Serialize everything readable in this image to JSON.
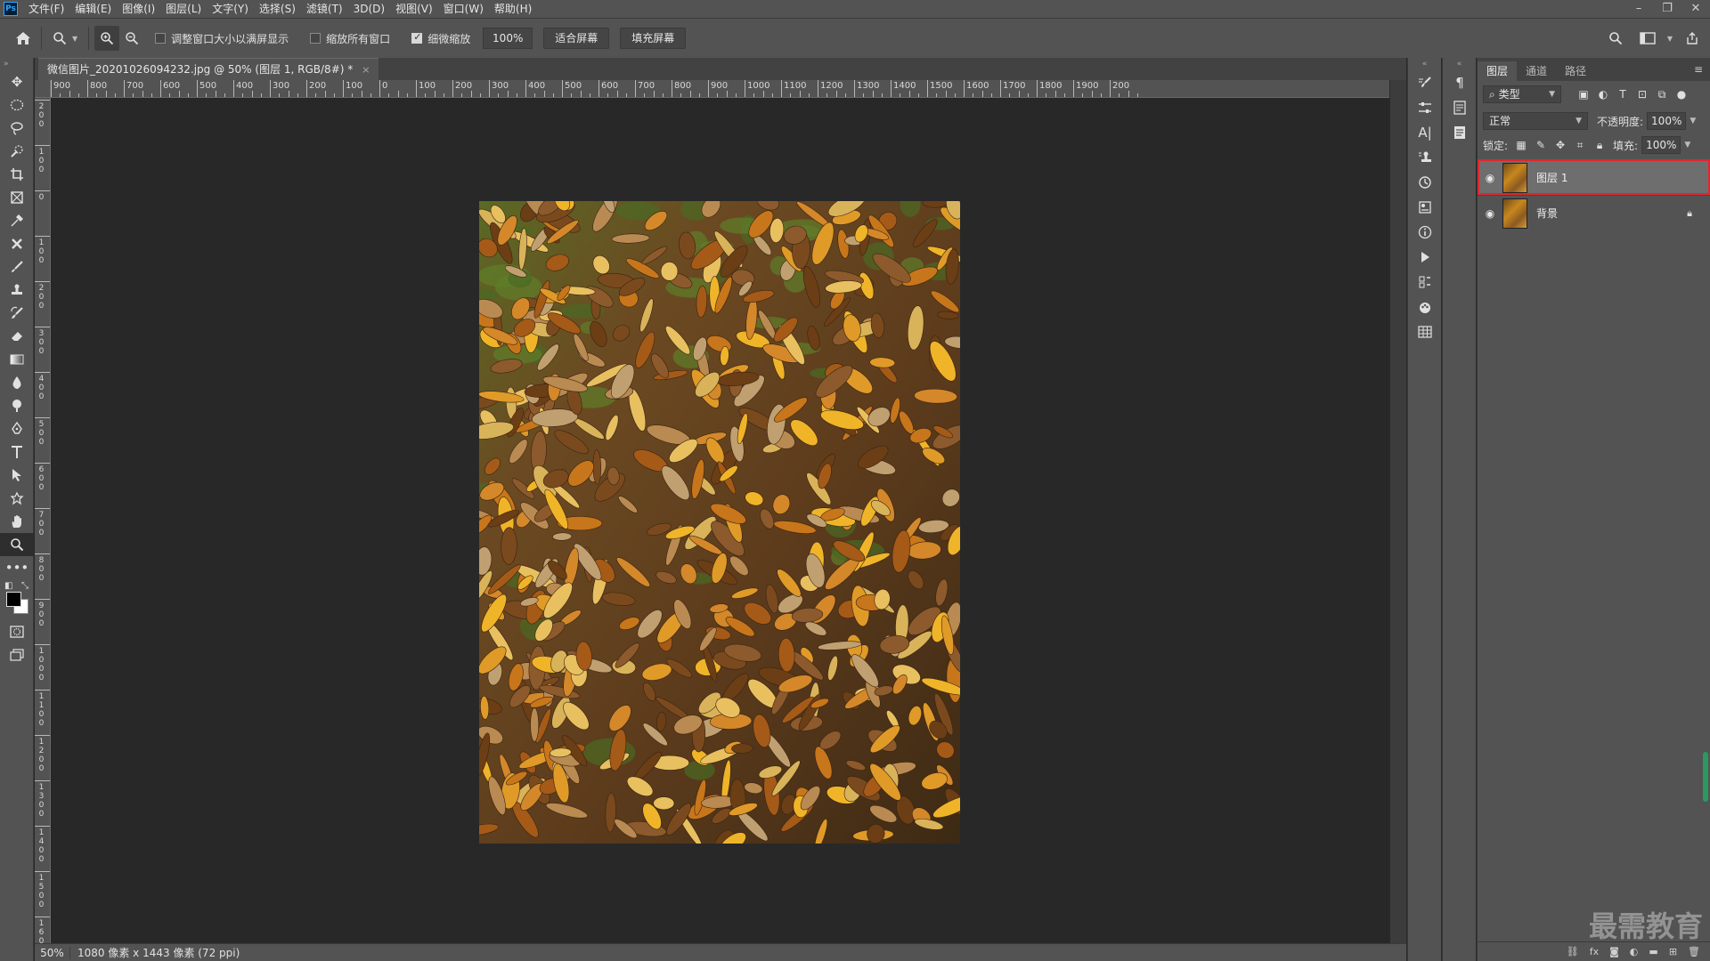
{
  "app": {
    "logo": "Ps"
  },
  "menu": [
    "文件(F)",
    "编辑(E)",
    "图像(I)",
    "图层(L)",
    "文字(Y)",
    "选择(S)",
    "滤镜(T)",
    "3D(D)",
    "视图(V)",
    "窗口(W)",
    "帮助(H)"
  ],
  "window_controls": {
    "minimize": "–",
    "restore": "❐",
    "close": "✕"
  },
  "options": {
    "resize_windows_label": "调整窗口大小以满屏显示",
    "resize_windows_checked": false,
    "zoom_all_label": "缩放所有窗口",
    "zoom_all_checked": false,
    "scrubby_zoom_label": "细微缩放",
    "scrubby_zoom_checked": true,
    "zoom_value": "100%",
    "fit_screen_label": "适合屏幕",
    "fill_screen_label": "填充屏幕"
  },
  "document": {
    "tab_title": "微信图片_20201026094232.jpg @ 50% (图层 1, RGB/8#) *",
    "close": "×"
  },
  "ruler": {
    "top_labels": [
      "900",
      "800",
      "700",
      "600",
      "500",
      "400",
      "300",
      "200",
      "100",
      "0",
      "100",
      "200",
      "300",
      "400",
      "500",
      "600",
      "700",
      "800",
      "900",
      "1000",
      "1100",
      "1200",
      "1300",
      "1400",
      "1500",
      "1600",
      "1700",
      "1800",
      "1900",
      "200"
    ],
    "left_labels": [
      "200",
      "100",
      "0",
      "100",
      "200",
      "300",
      "400",
      "500",
      "600",
      "700",
      "800",
      "900",
      "1000",
      "1100",
      "1200",
      "1300",
      "1400",
      "1500",
      "1600"
    ]
  },
  "status": {
    "zoom": "50%",
    "info": "1080 像素 x 1443 像素 (72 ppi)"
  },
  "layers_panel": {
    "tabs": [
      "图层",
      "通道",
      "路径"
    ],
    "active_tab": 0,
    "filter_type": "类型",
    "blend_mode": "正常",
    "opacity_label": "不透明度:",
    "opacity_value": "100%",
    "lock_label": "锁定:",
    "fill_label": "填充:",
    "fill_value": "100%",
    "layers": [
      {
        "name": "图层 1",
        "selected": true,
        "locked": false
      },
      {
        "name": "背景",
        "selected": false,
        "locked": true
      }
    ]
  },
  "watermark": "最需教育"
}
